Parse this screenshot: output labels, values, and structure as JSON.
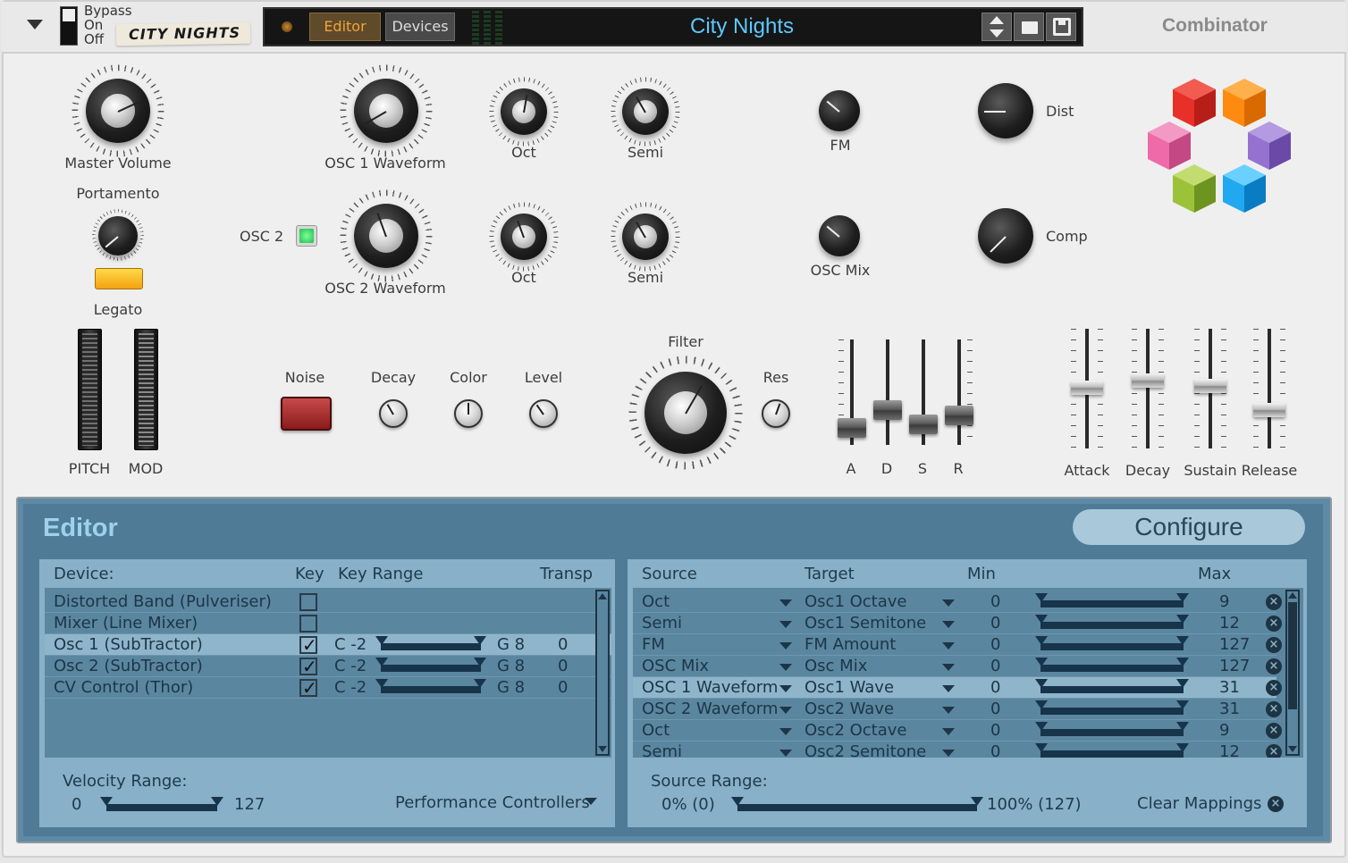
{
  "topbar": {
    "bypass_label": "Bypass",
    "on_label": "On",
    "off_label": "Off",
    "patch_tape": "CITY NIGHTS",
    "editor_tab": "Editor",
    "devices_tab": "Devices",
    "patch_name": "City Nights",
    "device_title": "Combinator"
  },
  "controls": {
    "master_volume": "Master Volume",
    "portamento": "Portamento",
    "legato": "Legato",
    "osc1_waveform": "OSC 1 Waveform",
    "osc2_waveform": "OSC 2 Waveform",
    "osc2": "OSC 2",
    "oct1": "Oct",
    "oct2": "Oct",
    "semi1": "Semi",
    "semi2": "Semi",
    "fm": "FM",
    "osc_mix": "OSC Mix",
    "dist": "Dist",
    "comp": "Comp",
    "pitch": "PITCH",
    "mod": "MOD",
    "noise": "Noise",
    "decay": "Decay",
    "color": "Color",
    "level": "Level",
    "filter": "Filter",
    "res": "Res",
    "a": "A",
    "d": "D",
    "s": "S",
    "r": "R",
    "attack": "Attack",
    "decay2": "Decay",
    "sustain": "Sustain",
    "release": "Release"
  },
  "editor": {
    "title": "Editor",
    "configure": "Configure",
    "left_headers": {
      "device": "Device:",
      "key": "Key",
      "key_range": "Key Range",
      "transp": "Transp"
    },
    "devices": [
      {
        "name": "Distorted Band (Pulveriser)",
        "key": false,
        "lo": "",
        "hi": "",
        "transp": ""
      },
      {
        "name": "Mixer (Line Mixer)",
        "key": false,
        "lo": "",
        "hi": "",
        "transp": ""
      },
      {
        "name": "Osc 1 (SubTractor)",
        "key": true,
        "lo": "C -2",
        "hi": "G 8",
        "transp": "0"
      },
      {
        "name": "Osc 2 (SubTractor)",
        "key": true,
        "lo": "C -2",
        "hi": "G 8",
        "transp": "0"
      },
      {
        "name": "CV Control (Thor)",
        "key": true,
        "lo": "C -2",
        "hi": "G 8",
        "transp": "0"
      }
    ],
    "velocity_range_label": "Velocity Range:",
    "velocity_min": "0",
    "velocity_max": "127",
    "perf_controllers": "Performance Controllers",
    "right_headers": {
      "source": "Source",
      "target": "Target",
      "min": "Min",
      "max": "Max"
    },
    "mappings": [
      {
        "source": "Oct",
        "target": "Osc1 Octave",
        "min": "0",
        "max": "9"
      },
      {
        "source": "Semi",
        "target": "Osc1 Semitone",
        "min": "0",
        "max": "12"
      },
      {
        "source": "FM",
        "target": "FM Amount",
        "min": "0",
        "max": "127"
      },
      {
        "source": "OSC Mix",
        "target": "Osc Mix",
        "min": "0",
        "max": "127"
      },
      {
        "source": "OSC 1 Waveform",
        "target": "Osc1 Wave",
        "min": "0",
        "max": "31"
      },
      {
        "source": "OSC 2 Waveform",
        "target": "Osc2 Wave",
        "min": "0",
        "max": "31"
      },
      {
        "source": "Oct",
        "target": "Osc2 Octave",
        "min": "0",
        "max": "9"
      },
      {
        "source": "Semi",
        "target": "Osc2 Semitone",
        "min": "0",
        "max": "12"
      }
    ],
    "source_range_label": "Source Range:",
    "source_min": "0% (0)",
    "source_max": "100% (127)",
    "clear_mappings": "Clear Mappings"
  },
  "colors": {
    "accent_orange": "#e8a020",
    "lcd_text": "#5ec8ff",
    "editor_bg": "#4f7b96",
    "editor_pane": "#88b0c8"
  }
}
